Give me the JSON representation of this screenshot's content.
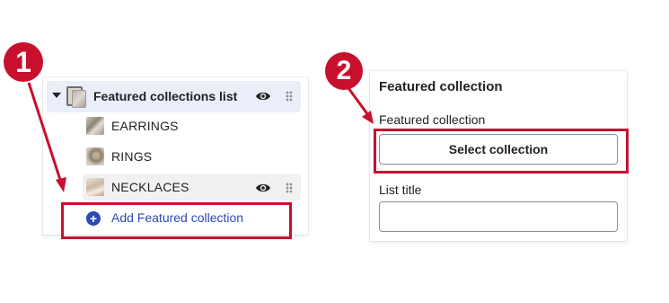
{
  "colors": {
    "annotation": "#c8102e",
    "link": "#2c49b8",
    "selected_row_bg": "#e9eef9",
    "hover_row_bg": "#f1f1f1"
  },
  "annotations": {
    "step1": "1",
    "step2": "2"
  },
  "left_panel": {
    "section_title": "Featured collections list",
    "section_icons": [
      "caret-down-icon",
      "stacked-images-icon",
      "eye-icon",
      "drag-handle-icon"
    ],
    "items": [
      {
        "label": "EARRINGS",
        "icon": "earrings-thumbnail"
      },
      {
        "label": "RINGS",
        "icon": "rings-thumbnail"
      },
      {
        "label": "NECKLACES",
        "icon": "necklaces-thumbnail",
        "hovered": true
      }
    ],
    "add_label": "Add Featured collection",
    "add_icon": "plus-circle-icon"
  },
  "right_panel": {
    "title": "Featured collection",
    "collection_label": "Featured collection",
    "select_button": "Select collection",
    "list_title_label": "List title",
    "list_title_value": ""
  }
}
